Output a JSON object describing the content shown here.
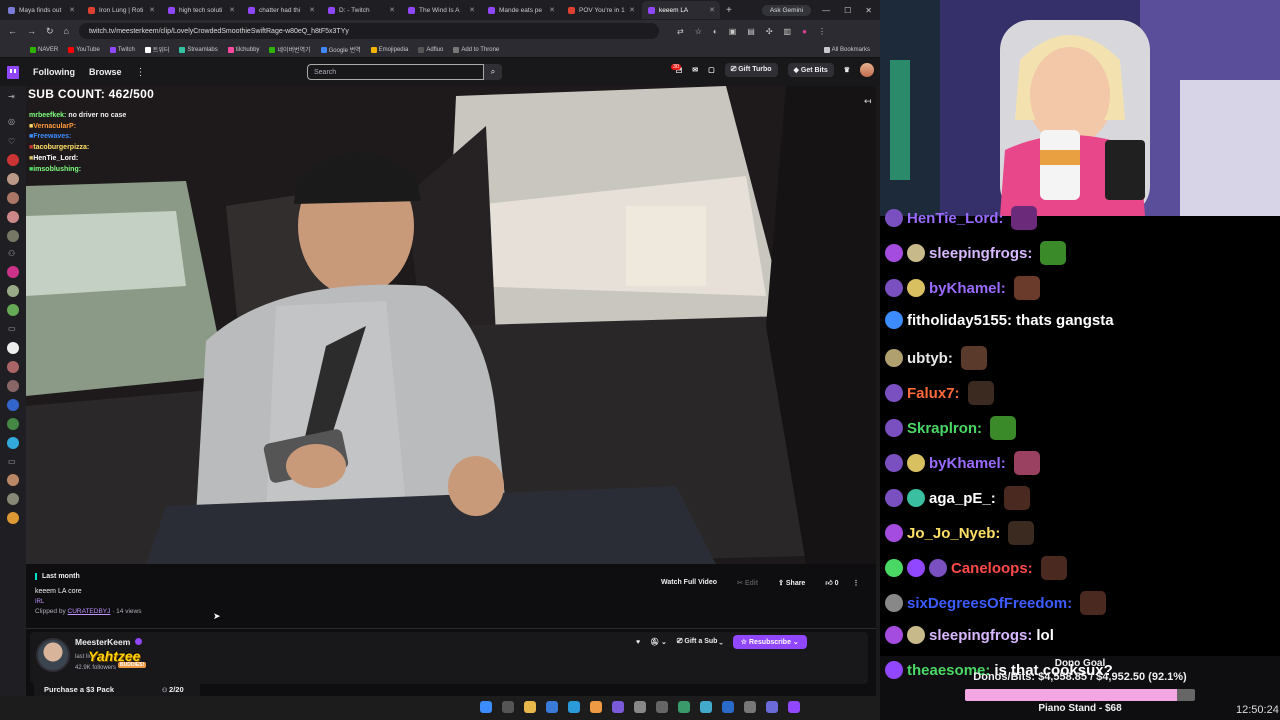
{
  "browser": {
    "tabs": [
      {
        "label": "Maya finds out",
        "color": "#7b7bd8"
      },
      {
        "label": "Iron Lung | Roti",
        "color": "#e04030"
      },
      {
        "label": "high tech soluti",
        "color": "#9146ff"
      },
      {
        "label": "chatter had thi",
        "color": "#9146ff"
      },
      {
        "label": "D: - Twitch",
        "color": "#9146ff"
      },
      {
        "label": "The Wind Is A",
        "color": "#9146ff"
      },
      {
        "label": "Mande eats pe",
        "color": "#9146ff"
      },
      {
        "label": "POV You're in 1",
        "color": "#e04030"
      },
      {
        "label": "keeem LA",
        "color": "#9146ff"
      }
    ],
    "new_tab": "+",
    "ask_gemini": "Ask Gemini",
    "url": "twitch.tv/meesterkeem/clip/LovelyCrowdedSmoothieSwiftRage-w80eQ_h8tF5x3TYy",
    "bookmarks": [
      {
        "label": "NAVER",
        "color": "#2db400"
      },
      {
        "label": "YouTube",
        "color": "#ff0000"
      },
      {
        "label": "Twitch",
        "color": "#9146ff"
      },
      {
        "label": "트위터",
        "color": "#ffffff"
      },
      {
        "label": "Streamlabs",
        "color": "#31c3a2"
      },
      {
        "label": "tilchubby",
        "color": "#ff4aa0"
      },
      {
        "label": "네이버번역기",
        "color": "#2db400"
      },
      {
        "label": "Google 번역",
        "color": "#4285f4"
      },
      {
        "label": "Emojipedia",
        "color": "#f4b400"
      },
      {
        "label": "Adfluo",
        "color": "#555555"
      },
      {
        "label": "Add to Throne",
        "color": "#777777"
      }
    ],
    "all_bookmarks": "All Bookmarks"
  },
  "twitch_nav": {
    "following": "Following",
    "browse": "Browse",
    "search_placeholder": "Search",
    "notif_count": "30",
    "gift_turbo": "Gift Turbo",
    "get_bits": "Get Bits"
  },
  "overlay": {
    "sub_count": "SUB COUNT: 462/500",
    "chat": [
      {
        "user": "mrbeefkek:",
        "text": "no driver no case",
        "color": "#7fff7f"
      },
      {
        "user": "VernacularP:",
        "text": "",
        "color": "#ff9a3c"
      },
      {
        "user": "Freewaves:",
        "text": "",
        "color": "#3c8cff"
      },
      {
        "user": "tacoburgerpizza:",
        "text": "",
        "color": "#ffe066"
      },
      {
        "user": "HenTie_Lord:",
        "text": "",
        "color": "#ffffff"
      },
      {
        "user": "imsoblushing:",
        "text": "",
        "color": "#7fff7f"
      }
    ]
  },
  "clip_info": {
    "last_month": "Last month",
    "title": "keeem LA core",
    "category": "IRL",
    "clipped_by_prefix": "Clipped by",
    "clipper": "CURATEDBYJ",
    "views": "· 14 views",
    "watch_full": "Watch Full Video",
    "edit": "Edit",
    "share": "Share",
    "likes": "0"
  },
  "channel": {
    "name": "MeesterKeem",
    "last_live": "last live",
    "followers": "42.9K followers",
    "gift_sub": "Gift a Sub",
    "resubscribe": "Resubscribe",
    "yahtzee": "Yahtzee",
    "yahtzee_sub": "BUDDIES!"
  },
  "purchase": {
    "label": "Purchase a $3 Pack",
    "count": "2/20",
    "progress": 0.1
  },
  "stream_chat": [
    {
      "user": "HenTie_Lord:",
      "text": "",
      "color": "#9b6bff",
      "badges": [
        "#7a4fbf"
      ],
      "emote": "#6b2a7a"
    },
    {
      "user": "sleepingfrogs:",
      "text": "",
      "color": "#d8b8ff",
      "badges": [
        "#a44be0",
        "#c7b98a"
      ],
      "emote": "#3a8a2a"
    },
    {
      "user": "byKhamel:",
      "text": "",
      "color": "#9b6bff",
      "badges": [
        "#7a4fbf",
        "#d8c060"
      ],
      "emote": "#6a3a2a"
    },
    {
      "user": "fitholiday5155:",
      "text": "thats gangsta",
      "color": "#ffffff",
      "badges": [
        "#3c8cff"
      ],
      "emote": ""
    },
    {
      "user": "ubtyb:",
      "text": "",
      "color": "#e8e8e8",
      "badges": [
        "#b0a070"
      ],
      "emote": "#5a3a2a"
    },
    {
      "user": "Falux7:",
      "text": "",
      "color": "#ff6a3c",
      "badges": [
        "#7a4fbf"
      ],
      "emote": "#3a2a20"
    },
    {
      "user": "Skraplron:",
      "text": "",
      "color": "#4ad864",
      "badges": [
        "#7a4fbf"
      ],
      "emote": "#3a8a2a"
    },
    {
      "user": "byKhamel:",
      "text": "",
      "color": "#9b6bff",
      "badges": [
        "#7a4fbf",
        "#d8c060"
      ],
      "emote": "#9a4060"
    },
    {
      "user": "aga_pE_:",
      "text": "",
      "color": "#ffffff",
      "badges": [
        "#7a4fbf",
        "#3ac0a0"
      ],
      "emote": "#4a2a20"
    },
    {
      "user": "Jo_Jo_Nyeb:",
      "text": "",
      "color": "#ffe066",
      "badges": [
        "#a44be0"
      ],
      "emote": "#3a2a20"
    },
    {
      "user": "Caneloops:",
      "text": "",
      "color": "#ff4a4a",
      "badges": [
        "#4ad864",
        "#9146ff",
        "#7a4fbf"
      ],
      "emote": "#4a2a20"
    },
    {
      "user": "sixDegreesOfFreedom:",
      "text": "",
      "color": "#3c5cff",
      "badges": [
        "#888888"
      ],
      "emote": "#4a2a20"
    },
    {
      "user": "sleepingfrogs:",
      "text": "lol",
      "color": "#d8b8ff",
      "badges": [
        "#a44be0",
        "#c7b98a"
      ],
      "emote": ""
    },
    {
      "user": "theaesome:",
      "text": "is that cooksux?",
      "color": "#4ad864",
      "badges": [
        "#9146ff"
      ],
      "emote": ""
    }
  ],
  "dono": {
    "title": "Dono Goal",
    "amounts": "Donos/Bits: $4,558.85 / $4,952.50 (92.1%)",
    "progress": 0.921,
    "sub": "Piano Stand - $68"
  },
  "clock": "12:50:24"
}
